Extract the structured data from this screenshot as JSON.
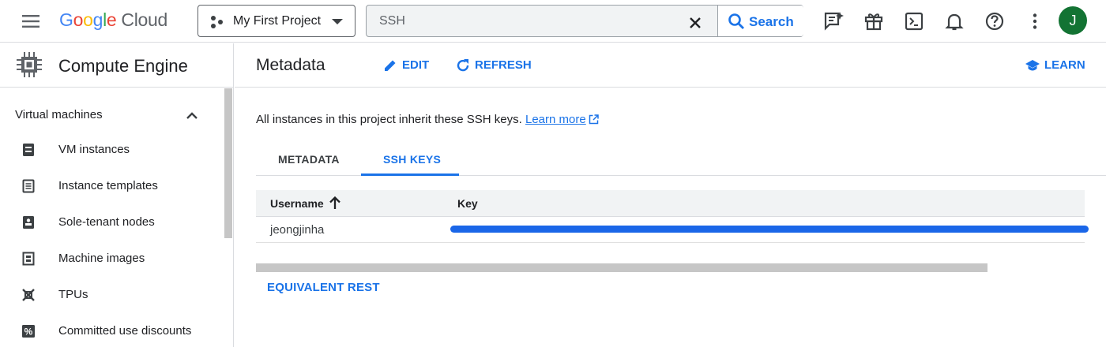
{
  "app": {
    "logo_google": [
      "G",
      "o",
      "o",
      "g",
      "l",
      "e"
    ],
    "logo_cloud": "Cloud",
    "project_name": "My First Project",
    "search": {
      "value": "SSH",
      "button_label": "Search"
    },
    "avatar_initial": "J",
    "top_icons": [
      "menu-icon",
      "gemini-assist-icon",
      "gift-icon",
      "cloud-shell-icon",
      "notifications-icon",
      "help-icon",
      "more-vert-icon"
    ]
  },
  "sidebar": {
    "product_title": "Compute Engine",
    "section_label": "Virtual machines",
    "items": [
      {
        "label": "VM instances",
        "icon": "vm-instances-icon"
      },
      {
        "label": "Instance templates",
        "icon": "instance-templates-icon"
      },
      {
        "label": "Sole-tenant nodes",
        "icon": "sole-tenant-icon"
      },
      {
        "label": "Machine images",
        "icon": "machine-images-icon"
      },
      {
        "label": "TPUs",
        "icon": "tpu-icon"
      },
      {
        "label": "Committed use discounts",
        "icon": "percent-icon"
      }
    ]
  },
  "main": {
    "title": "Metadata",
    "edit_label": "EDIT",
    "refresh_label": "REFRESH",
    "learn_label": "LEARN",
    "info_text": "All instances in this project inherit these SSH keys.",
    "learn_more_label": "Learn more",
    "tabs": [
      {
        "label": "METADATA",
        "active": false
      },
      {
        "label": "SSH KEYS",
        "active": true
      }
    ],
    "table": {
      "columns": [
        "Username",
        "Key"
      ],
      "rows": [
        {
          "username": "jeongjinha",
          "key": "[redacted]"
        }
      ]
    },
    "equivalent_rest_label": "EQUIVALENT REST"
  },
  "colors": {
    "accent": "#1a73e8",
    "avatar_bg": "#137333",
    "redaction": "#1a66e8"
  }
}
